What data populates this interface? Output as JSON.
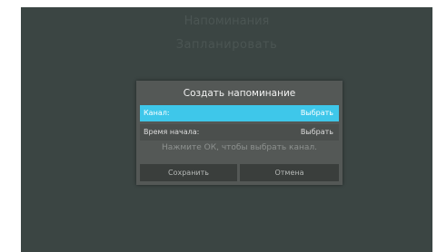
{
  "background": {
    "title": "Напоминания",
    "subtitle": "Запланировать"
  },
  "dialog": {
    "title": "Создать напоминание",
    "rows": [
      {
        "label": "Канал:",
        "value": "Выбрать"
      },
      {
        "label": "Время начала:",
        "value": "Выбрать"
      }
    ],
    "hint": "Нажмите ОК, чтобы выбрать канал.",
    "buttons": {
      "save": "Сохранить",
      "cancel": "Отмена"
    }
  },
  "colors": {
    "screen_bg": "#3b4543",
    "dialog_bg": "#545856",
    "selected_row": "#3ec7ea",
    "button_bg": "#3a3e3c"
  }
}
